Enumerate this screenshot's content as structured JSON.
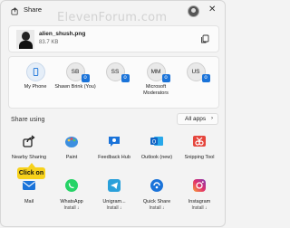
{
  "window": {
    "title": "Share",
    "watermark": "ElevenForum.com"
  },
  "file": {
    "name": "alien_shush.png",
    "size": "83.7 KB"
  },
  "nearby": [
    {
      "initials": "",
      "label": "My Phone"
    },
    {
      "initials": "SB",
      "label": "Shawn Brink (You)"
    },
    {
      "initials": "SS",
      "label": ""
    },
    {
      "initials": "MM",
      "label": "Microsoft Moderators"
    },
    {
      "initials": "US",
      "label": ""
    }
  ],
  "share_using": {
    "label": "Share using",
    "all_apps": "All apps"
  },
  "apps_row1": [
    {
      "name": "Nearby Sharing"
    },
    {
      "name": "Paint"
    },
    {
      "name": "Feedback Hub"
    },
    {
      "name": "Outlook (new)"
    },
    {
      "name": "Snipping Tool"
    }
  ],
  "apps_row2": [
    {
      "name": "Mail",
      "sub": ""
    },
    {
      "name": "WhatsApp",
      "sub": "Install ↓"
    },
    {
      "name": "Unigram...",
      "sub": "Install ↓"
    },
    {
      "name": "Quick Share",
      "sub": "Install ↓"
    },
    {
      "name": "Instagram",
      "sub": "Install ↓"
    }
  ],
  "callout": "Click on",
  "colors": {
    "accent": "#1a73d9",
    "callout": "#f7d21c"
  }
}
